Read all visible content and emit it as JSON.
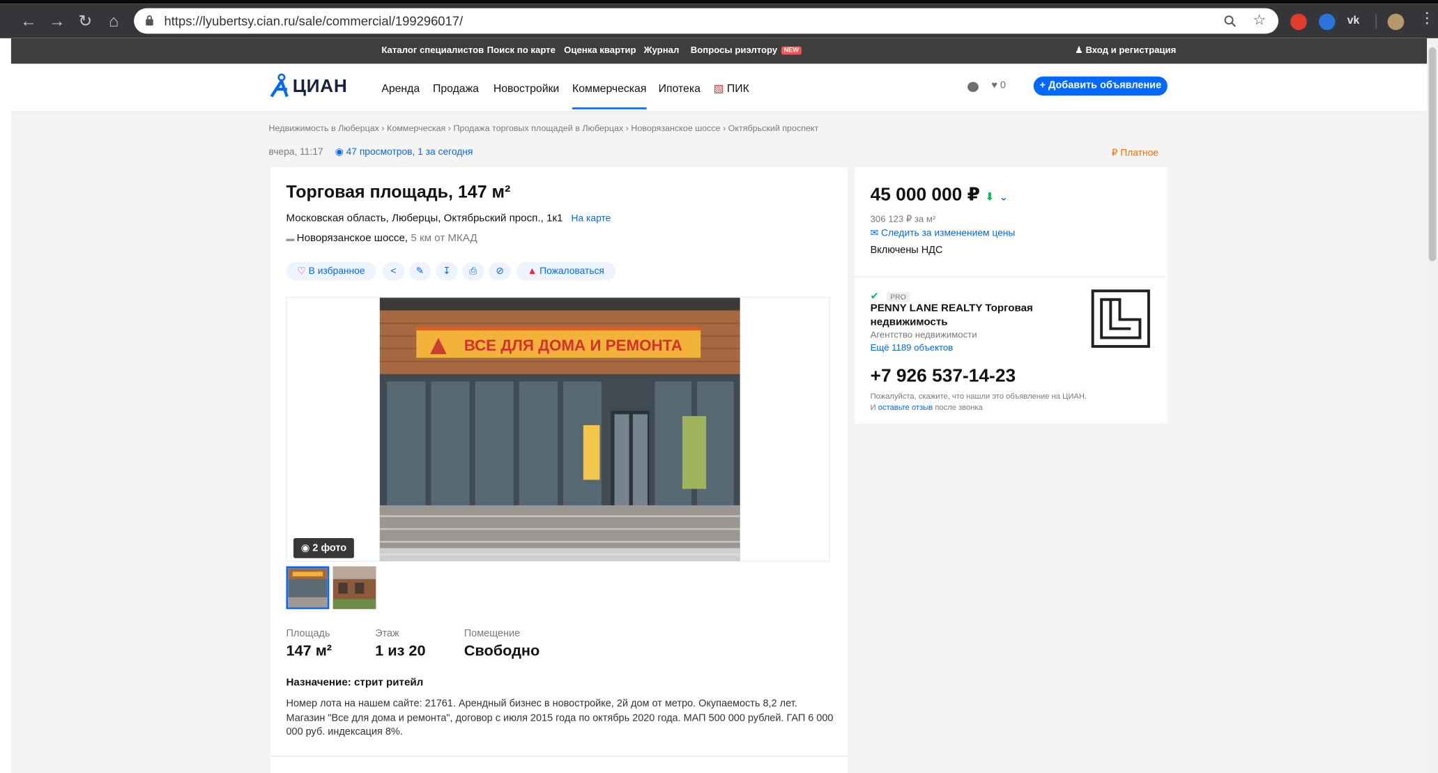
{
  "browser": {
    "url": "https://lyubertsy.cian.ru/sale/commercial/199296017/"
  },
  "topbar": {
    "links": [
      "Каталог специалистов",
      "Поиск по карте",
      "Оценка квартир",
      "Журнал",
      "Вопросы риэлтору"
    ],
    "new_badge": "NEW",
    "login": "Вход и регистрация"
  },
  "header": {
    "logo": "ЦИАН",
    "menu": [
      "Аренда",
      "Продажа",
      "Новостройки",
      "Коммерческая",
      "Ипотека",
      "ПИК"
    ],
    "favorites_count": "0",
    "add_button": "+ Добавить объявление"
  },
  "breadcrumbs": [
    "Недвижимость в Люберцах",
    "Коммерческая",
    "Продажа торговых площадей в Люберцах",
    "Новорязанское шоссе",
    "Октябрьский проспект"
  ],
  "meta": {
    "date": "вчера, 11:17",
    "views": "47 просмотров, 1 за сегодня",
    "paid": "Платное"
  },
  "listing": {
    "title": "Торговая площадь, 147 м²",
    "address": "Московская область, Люберцы, Октябрьский просп., 1к1",
    "map_link": "На карте",
    "highway": "Новорязанское шоссе,",
    "distance": "5 км от МКАД",
    "favorite": "В избранное",
    "complain": "Пожаловаться",
    "photo_count": "2 фото",
    "store_sign": "ВСЕ ДЛЯ ДОМА И РЕМОНТА",
    "facts": [
      {
        "label": "Площадь",
        "value": "147 м²"
      },
      {
        "label": "Этаж",
        "value": "1 из 20"
      },
      {
        "label": "Помещение",
        "value": "Свободно"
      }
    ],
    "purpose": "Назначение: стрит ритейл",
    "description": "Номер лота на нашем сайте: 21761. Арендный бизнес в новостройке, 2й дом от метро. Окупаемость 8,2 лет. Магазин \"Все для дома и ремонта\", договор с июля 2015 года по октябрь 2020 года. МАП 500 000 рублей. ГАП 6 000 000 руб. индексация 8%."
  },
  "price": {
    "value": "45 000 000 ₽",
    "per_meter": "306 123 ₽ за м²",
    "follow": "Следить за изменением цены",
    "vat": "Включены НДС"
  },
  "agent": {
    "badge": "PRO",
    "name": "PENNY LANE REALTY Торговая недвижимость",
    "type": "Агентство недвижимости",
    "objects": "Ещё 1189 объектов",
    "phone": "+7 926 537-14-23",
    "note_prefix": "Пожалуйста, скажите, что нашли это объявление на ЦИАН. И",
    "note_link": "оставьте отзыв",
    "note_suffix": "после звонка"
  },
  "colors": {
    "accent": "#0468ff",
    "chrome": "#35363a",
    "topbar": "#3e3e3e",
    "paid": "#ff6f00"
  }
}
